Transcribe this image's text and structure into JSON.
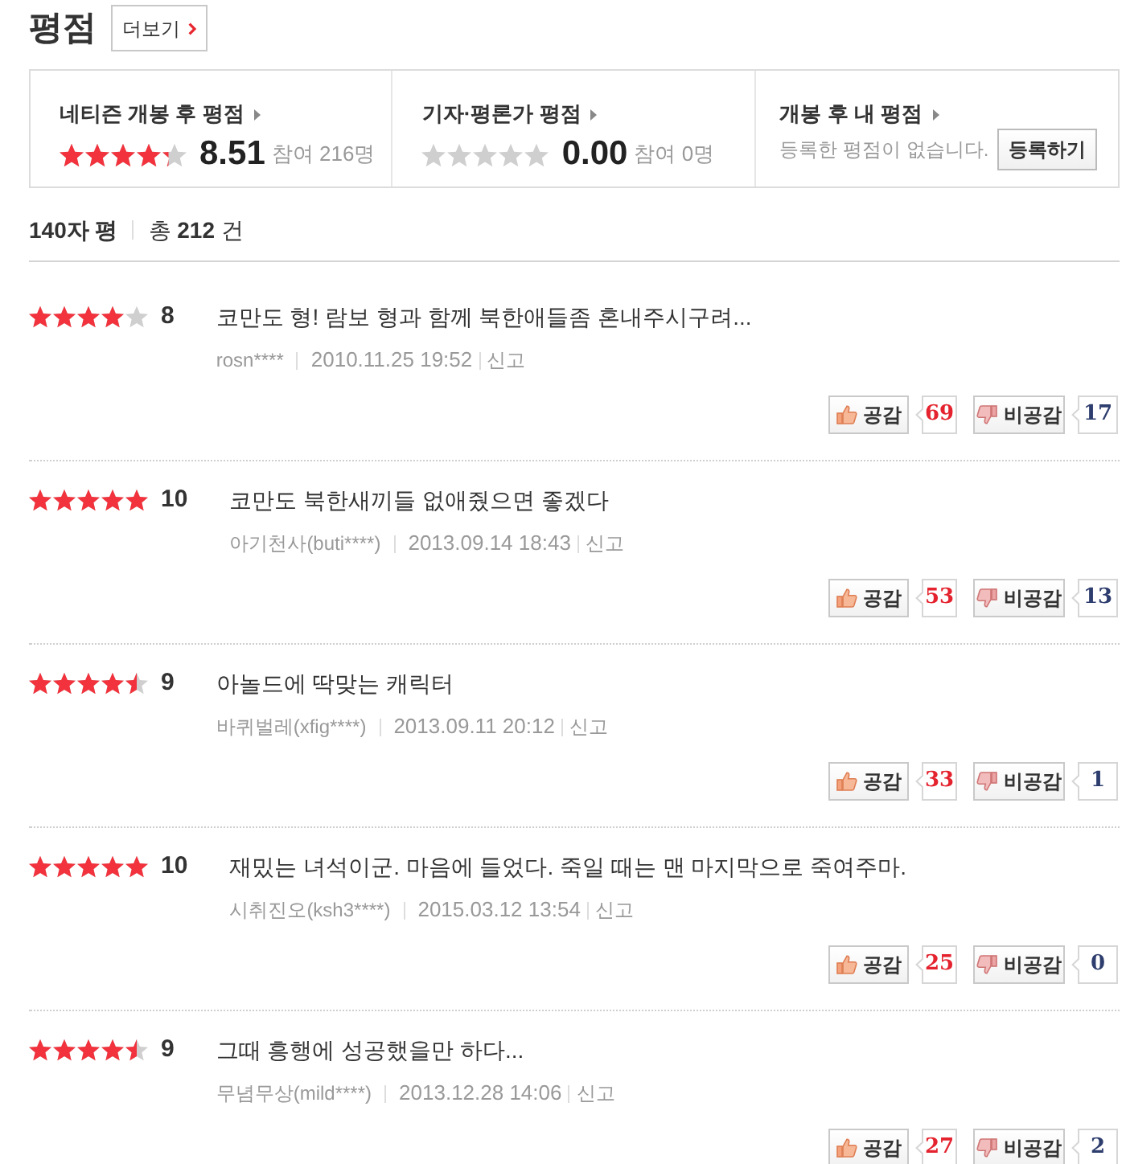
{
  "header": {
    "title": "평점",
    "more_button": "더보기"
  },
  "summary": [
    {
      "kind": "rating",
      "label": "네티즌 개봉 후 평점",
      "stars": 4.25,
      "score": "8.51",
      "participants": "참여 216명"
    },
    {
      "kind": "rating",
      "label": "기자·평론가 평점",
      "stars": 0,
      "score": "0.00",
      "participants": "참여 0명"
    },
    {
      "kind": "mine",
      "label": "개봉 후 내 평점",
      "message": "등록한 평점이 없습니다.",
      "button": "등록하기"
    }
  ],
  "list_header": {
    "title": "140자 평",
    "total": "총 **212** 건"
  },
  "reviews": [
    {
      "stars": 4,
      "score": "8",
      "text": "코만도 형! 람보 형과 함께 북한애들좀 혼내주시구려...",
      "author": "rosn****",
      "date": "2010.11.25 19:52",
      "report": "신고",
      "like_button": "공감",
      "likes": "69",
      "dislike_button": "비공감",
      "dislikes": "17"
    },
    {
      "stars": 5,
      "score": "10",
      "text": "코만도 북한새끼들 없애줬으면 좋겠다",
      "author": "아기천사(buti****)",
      "date": "2013.09.14 18:43",
      "report": "신고",
      "like_button": "공감",
      "likes": "53",
      "dislike_button": "비공감",
      "dislikes": "13"
    },
    {
      "stars": 4.5,
      "score": "9",
      "text": "아놀드에 딱맞는 캐릭터",
      "author": "바퀴벌레(xfig****)",
      "date": "2013.09.11 20:12",
      "report": "신고",
      "like_button": "공감",
      "likes": "33",
      "dislike_button": "비공감",
      "dislikes": "1"
    },
    {
      "stars": 5,
      "score": "10",
      "text": "재밌는 녀석이군. 마음에 들었다. 죽일 때는 맨 마지막으로 죽여주마.",
      "author": "시취진오(ksh3****)",
      "date": "2015.03.12 13:54",
      "report": "신고",
      "like_button": "공감",
      "likes": "25",
      "dislike_button": "비공감",
      "dislikes": "0"
    },
    {
      "stars": 4.5,
      "score": "9",
      "text": "그때 흥행에 성공했을만 하다...",
      "author": "무념무상(mild****)",
      "date": "2013.12.28 14:06",
      "report": "신고",
      "like_button": "공감",
      "likes": "27",
      "dislike_button": "비공감",
      "dislikes": "2"
    }
  ]
}
